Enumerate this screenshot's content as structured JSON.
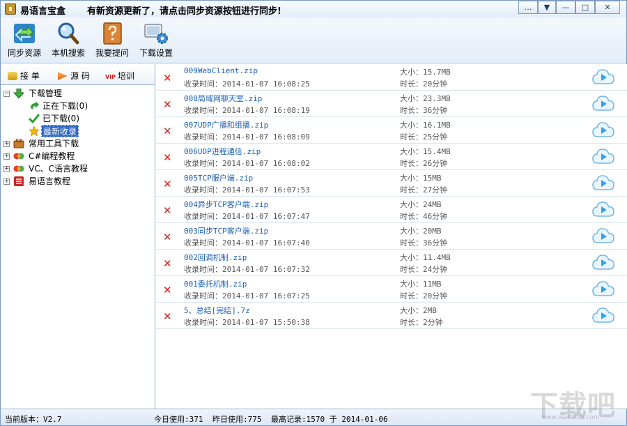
{
  "window": {
    "title": "易语言宝盒",
    "notice": "有新资源更新了，请点击同步资源按钮进行同步!"
  },
  "title_controls": {
    "feedback": "…",
    "menu": "▼",
    "minimize": "—",
    "maximize": "□",
    "close": "✕"
  },
  "toolbar": {
    "sync_label": "同步资源",
    "search_label": "本机搜索",
    "ask_label": "我要提问",
    "settings_label": "下载设置"
  },
  "left_tabs": {
    "orders": "接 单",
    "source": "源 码",
    "vip_training": "培训",
    "vip_badge": "VIP"
  },
  "tree": {
    "download_manager": "下载管理",
    "downloading": "正在下载(0)",
    "downloaded": "已下载(0)",
    "latest": "最新收录",
    "tools": "常用工具下载",
    "csharp": "C#编程教程",
    "vc": "VC、C语言教程",
    "eyuyan": "易语言教程"
  },
  "labels": {
    "time_prefix": "收录时间：",
    "size_prefix": "大小：",
    "dur_prefix": "时长："
  },
  "items": [
    {
      "name": "009WebClient.zip",
      "time": "2014-01-07 16:08:25",
      "size": "15.7MB",
      "duration": "20分钟"
    },
    {
      "name": "008局域网聊天室.zip",
      "time": "2014-01-07 16:08:19",
      "size": "23.3MB",
      "duration": "36分钟"
    },
    {
      "name": "007UDP广播和组播.zip",
      "time": "2014-01-07 16:08:09",
      "size": "16.1MB",
      "duration": "25分钟"
    },
    {
      "name": "006UDP进程通信.zip",
      "time": "2014-01-07 16:08:02",
      "size": "15.4MB",
      "duration": "26分钟"
    },
    {
      "name": "005TCP服户端.zip",
      "time": "2014-01-07 16:07:53",
      "size": "15MB",
      "duration": "27分钟"
    },
    {
      "name": "004异步TCP客户端.zip",
      "time": "2014-01-07 16:07:47",
      "size": "24MB",
      "duration": "46分钟"
    },
    {
      "name": "003同步TCP客户端.zip",
      "time": "2014-01-07 16:07:40",
      "size": "20MB",
      "duration": "36分钟"
    },
    {
      "name": "002回调机制.zip",
      "time": "2014-01-07 16:07:32",
      "size": "11.4MB",
      "duration": "24分钟"
    },
    {
      "name": "001委托机制.zip",
      "time": "2014-01-07 16:07:25",
      "size": "11MB",
      "duration": "20分钟"
    },
    {
      "name": "5、总结[完结].7z",
      "time": "2014-01-07 15:50:38",
      "size": "2MB",
      "duration": "2分钟"
    }
  ],
  "status": {
    "version": "当前版本：V2.7",
    "today": "今日使用:371",
    "yesterday": "昨日使用:775",
    "record": "最高记录:1570 于 2014-01-06"
  },
  "watermark": {
    "main": "下载吧",
    "sub": "www.xiazaiba.com"
  },
  "colors": {
    "accent": "#1a5fb4",
    "delete": "#d81b1b",
    "play": "#3aa0e0",
    "selected": "#316ac5"
  }
}
